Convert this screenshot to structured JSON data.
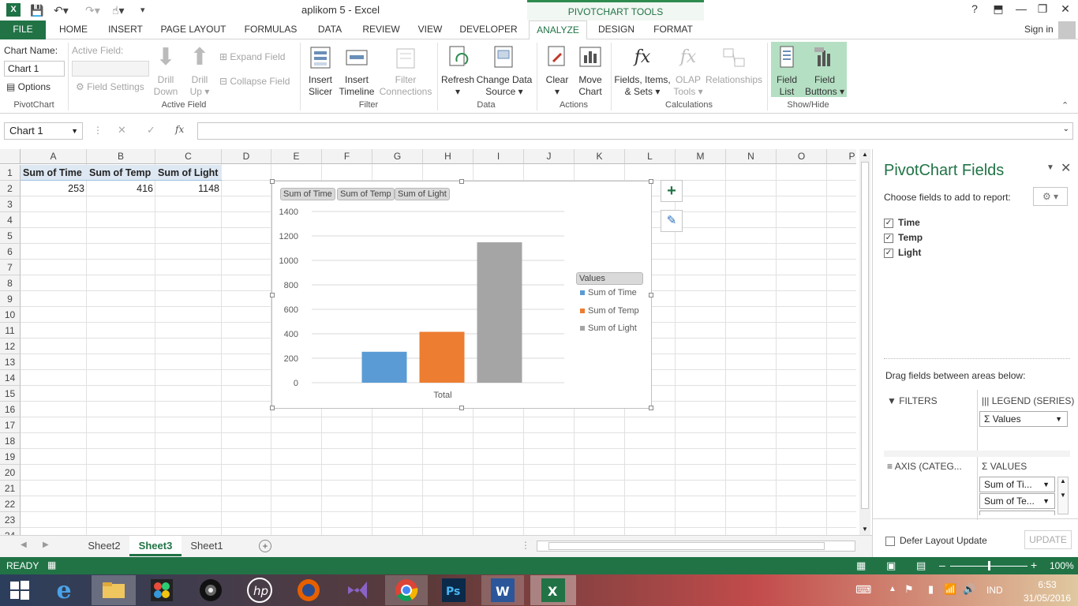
{
  "window": {
    "title": "aplikom 5 - Excel",
    "contextual_tools": "PIVOTCHART TOOLS",
    "help": "?",
    "min": "—",
    "restore": "❐",
    "close": "✕"
  },
  "tabs": [
    {
      "label": "FILE"
    },
    {
      "label": "HOME"
    },
    {
      "label": "INSERT"
    },
    {
      "label": "PAGE LAYOUT"
    },
    {
      "label": "FORMULAS"
    },
    {
      "label": "DATA"
    },
    {
      "label": "REVIEW"
    },
    {
      "label": "VIEW"
    },
    {
      "label": "DEVELOPER"
    },
    {
      "label": "ANALYZE"
    },
    {
      "label": "DESIGN"
    },
    {
      "label": "FORMAT"
    }
  ],
  "sign_in": "Sign in",
  "ribbon": {
    "chart_name_label": "Chart Name:",
    "chart_name_value": "Chart 1",
    "options": "Options",
    "pivotchart_group": "PivotChart",
    "active_field_label": "Active Field:",
    "field_settings": "Field Settings",
    "drill_down": [
      "Drill",
      "Down"
    ],
    "drill_up": [
      "Drill",
      "Up"
    ],
    "expand_field": "Expand Field",
    "collapse_field": "Collapse Field",
    "active_field_group": "Active Field",
    "insert_slicer": [
      "Insert",
      "Slicer"
    ],
    "insert_timeline": [
      "Insert",
      "Timeline"
    ],
    "filter_connections": [
      "Filter",
      "Connections"
    ],
    "filter_group": "Filter",
    "refresh": "Refresh",
    "change_data_source": [
      "Change Data",
      "Source"
    ],
    "data_group": "Data",
    "clear": "Clear",
    "move_chart": [
      "Move",
      "Chart"
    ],
    "actions_group": "Actions",
    "fields_items_sets": [
      "Fields, Items,",
      "& Sets"
    ],
    "olap_tools": [
      "OLAP",
      "Tools"
    ],
    "relationships": "Relationships",
    "calculations_group": "Calculations",
    "field_list": [
      "Field",
      "List"
    ],
    "field_buttons": [
      "Field",
      "Buttons"
    ],
    "showhide_group": "Show/Hide"
  },
  "formula_bar": {
    "name_box": "Chart 1",
    "fx": "fx",
    "cancel": "✕",
    "enter": "✓",
    "value": ""
  },
  "columns": [
    "A",
    "B",
    "C",
    "D",
    "E",
    "F",
    "G",
    "H",
    "I",
    "J",
    "K",
    "L",
    "M",
    "N",
    "O",
    "P"
  ],
  "rows": [
    "1",
    "2",
    "3",
    "4",
    "5",
    "6",
    "7",
    "8",
    "9",
    "10",
    "11",
    "12",
    "13",
    "14",
    "15",
    "16",
    "17",
    "18",
    "19",
    "20",
    "21",
    "22",
    "23",
    "24"
  ],
  "cells": {
    "a1": "Sum of Time",
    "b1": "Sum of Temp",
    "c1": "Sum of Light",
    "a2": "253",
    "b2": "416",
    "c2": "1148"
  },
  "chart_data": {
    "type": "bar",
    "categories": [
      "Total"
    ],
    "series": [
      {
        "name": "Sum of Time",
        "values": [
          253
        ],
        "color": "#5b9bd5"
      },
      {
        "name": "Sum of Temp",
        "values": [
          416
        ],
        "color": "#ed7d31"
      },
      {
        "name": "Sum of Light",
        "values": [
          1148
        ],
        "color": "#a5a5a5"
      }
    ],
    "ylim": [
      0,
      1400
    ],
    "yticks": [
      "0",
      "200",
      "400",
      "600",
      "800",
      "1000",
      "1200",
      "1400"
    ],
    "legend_title": "Values",
    "legend_position": "right",
    "field_buttons": [
      "Sum of Time",
      "Sum of Temp",
      "Sum of Light"
    ],
    "grid": true
  },
  "chart_tools": {
    "add": "+",
    "style": "✎"
  },
  "sheet_tabs": [
    {
      "label": "Sheet2"
    },
    {
      "label": "Sheet3",
      "active": true
    },
    {
      "label": "Sheet1"
    }
  ],
  "status": {
    "ready": "READY",
    "zoom": "100%",
    "zoom_fraction": 0.5
  },
  "panel": {
    "title": "PivotChart Fields",
    "choose": "Choose fields to add to report:",
    "fields": [
      {
        "label": "Time",
        "checked": true
      },
      {
        "label": "Temp",
        "checked": true
      },
      {
        "label": "Light",
        "checked": true
      }
    ],
    "drag_label": "Drag fields between areas below:",
    "filters": "FILTERS",
    "legend": "LEGEND (SERIES)",
    "legend_item": "Values",
    "axis": "AXIS (CATEG...",
    "values": "VALUES",
    "values_items": [
      "Sum of Ti...",
      "Sum of Te..."
    ],
    "defer": "Defer Layout Update",
    "update": "UPDATE"
  },
  "taskbar": {
    "lang": "IND",
    "time": "6:53",
    "date": "31/05/2016"
  }
}
